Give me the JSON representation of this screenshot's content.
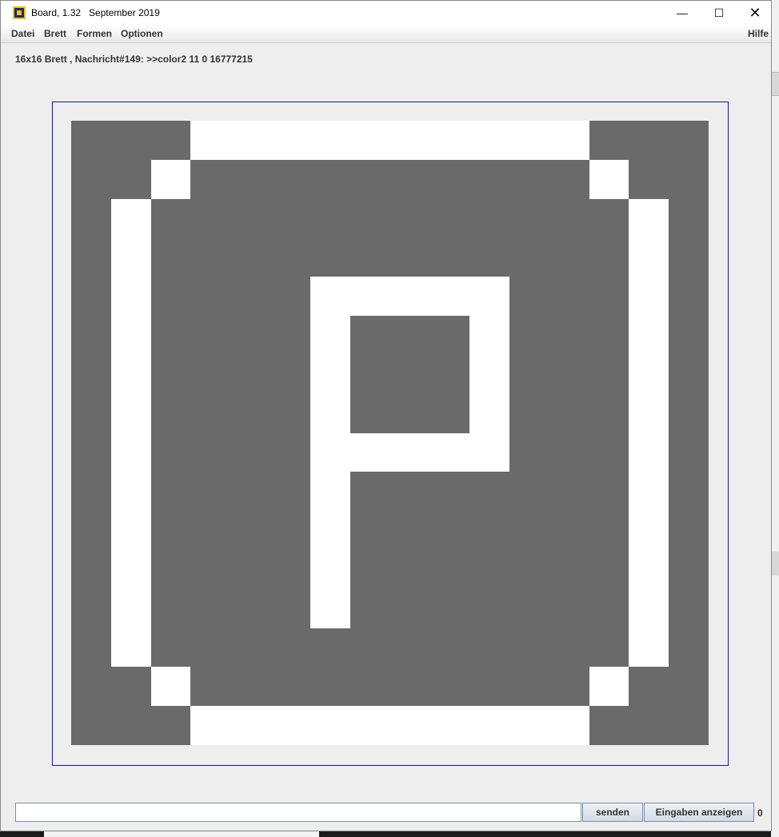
{
  "window": {
    "title": "Board, 1.32   September 2019",
    "controls": {
      "minimize": "—",
      "maximize": "☐",
      "close": "✕"
    }
  },
  "menu": {
    "items": [
      "Datei",
      "Brett",
      "Formen",
      "Optionen"
    ],
    "help": "Hilfe"
  },
  "status": "16x16 Brett , Nachricht#149: >>color2 11 0 16777215",
  "board": {
    "size": 16,
    "colors": {
      "dark": "#6a6a6a",
      "light": "#ffffff",
      "frame": "#1515a0"
    },
    "pattern": [
      "...WWWWWWWWWW...",
      "..W..........W..",
      ".W............W.",
      ".W............W.",
      ".W....WWWWW...W.",
      ".W....W...W...W.",
      ".W....W...W...W.",
      ".W....W...W...W.",
      ".W....WWWWW...W.",
      ".W....W.......W.",
      ".W....W.......W.",
      ".W....W.......W.",
      ".W....W.......W.",
      ".W............W.",
      "..W..........W..",
      "...WWWWWWWWWW..."
    ]
  },
  "input": {
    "value": "",
    "placeholder": ""
  },
  "buttons": {
    "send": "senden",
    "show_inputs": "Eingaben anzeigen"
  },
  "counter": "0"
}
